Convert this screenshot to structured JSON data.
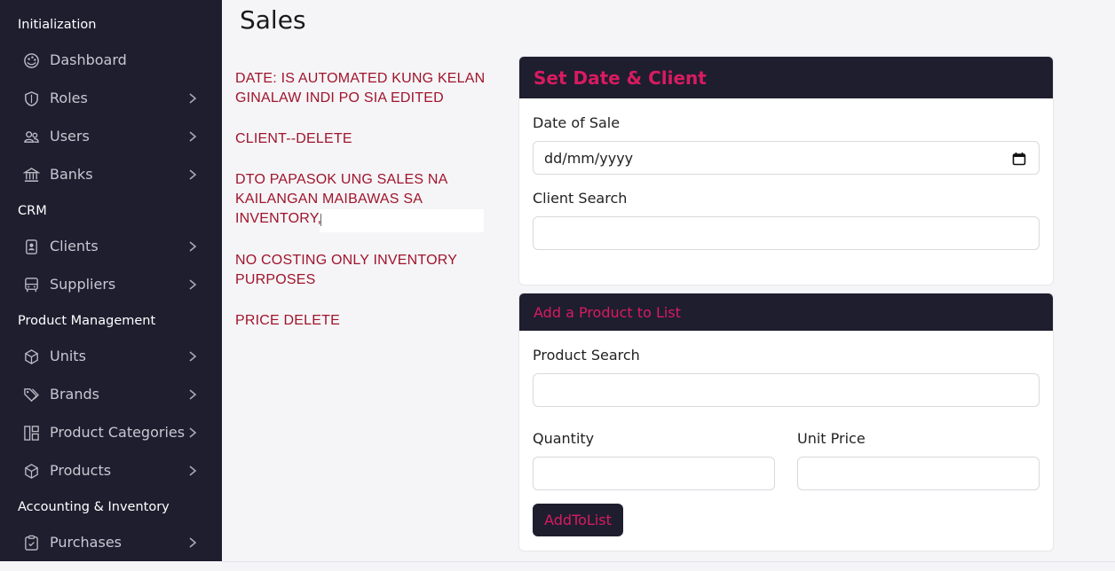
{
  "sidebar": {
    "sections": [
      {
        "title": "Initialization"
      },
      {
        "title": "CRM"
      },
      {
        "title": "Product Management"
      },
      {
        "title": "Accounting & Inventory"
      }
    ],
    "items": [
      {
        "label": "Dashboard",
        "icon": "palette-icon"
      },
      {
        "label": "Roles",
        "icon": "shield-icon"
      },
      {
        "label": "Users",
        "icon": "users-icon"
      },
      {
        "label": "Banks",
        "icon": "bank-icon"
      },
      {
        "label": "Clients",
        "icon": "contact-badge-icon"
      },
      {
        "label": "Suppliers",
        "icon": "bus-icon"
      },
      {
        "label": "Units",
        "icon": "box-icon"
      },
      {
        "label": "Brands",
        "icon": "tags-icon"
      },
      {
        "label": "Product Categories",
        "icon": "grid-icon"
      },
      {
        "label": "Products",
        "icon": "box-icon"
      },
      {
        "label": "Purchases",
        "icon": "clipboard-icon"
      }
    ]
  },
  "page": {
    "title": "Sales"
  },
  "notes": [
    {
      "line1": "DATE: IS AUTOMATED KUNG KELAN",
      "line2": "GINALAW INDI PO SIA EDITED"
    },
    {
      "line1": "CLIENT--DELETE"
    },
    {
      "line1": "DTO PAPASOK UNG SALES NA",
      "line2": "KAILANGAN MAIBAWAS SA",
      "line3": "INVENTORY,"
    },
    {
      "line1": "NO COSTING ONLY INVENTORY",
      "line2": "PURPOSES"
    },
    {
      "line1": "PRICE DELETE"
    }
  ],
  "set_date_client": {
    "header": "Set Date & Client",
    "date_label": "Date of Sale",
    "date_value": "dd/mm/yyyy",
    "client_label": "Client Search",
    "client_value": ""
  },
  "add_product": {
    "header": "Add a Product to List",
    "product_label": "Product Search",
    "product_value": "",
    "quantity_label": "Quantity",
    "quantity_value": "",
    "unit_price_label": "Unit Price",
    "unit_price_value": "",
    "button_label": "AddToList"
  },
  "colors": {
    "sidebar_bg": "#1e1e2f",
    "accent": "#d81b60",
    "note_text": "#a0142c"
  }
}
